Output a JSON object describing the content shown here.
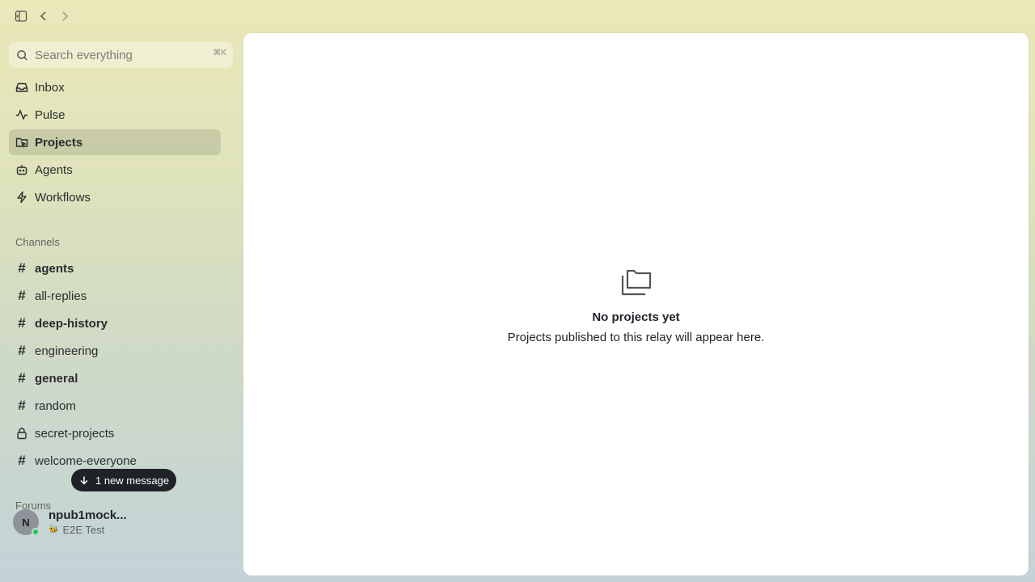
{
  "search": {
    "placeholder": "Search everything",
    "shortcut": "⌘K"
  },
  "nav": [
    {
      "label": "Inbox",
      "icon": "inbox-icon"
    },
    {
      "label": "Pulse",
      "icon": "pulse-icon"
    },
    {
      "label": "Projects",
      "icon": "projects-icon",
      "active": true
    },
    {
      "label": "Agents",
      "icon": "bot-icon"
    },
    {
      "label": "Workflows",
      "icon": "lightning-icon"
    }
  ],
  "channels_label": "Channels",
  "channels": [
    {
      "label": "agents",
      "unread": true
    },
    {
      "label": "all-replies",
      "unread": false
    },
    {
      "label": "deep-history",
      "unread": true
    },
    {
      "label": "engineering",
      "unread": false
    },
    {
      "label": "general",
      "unread": true
    },
    {
      "label": "random",
      "unread": false
    },
    {
      "label": "secret-projects",
      "unread": false,
      "private": true
    },
    {
      "label": "welcome-everyone",
      "unread": false
    }
  ],
  "forums_label": "Forums",
  "toast": {
    "label": "1 new message"
  },
  "user": {
    "initial": "N",
    "name": "npub1mock...",
    "status_emoji": "🐝",
    "status": "E2E Test",
    "online_color": "#22c55e"
  },
  "empty_state": {
    "title": "No projects yet",
    "subtitle": "Projects published to this relay will appear here."
  }
}
